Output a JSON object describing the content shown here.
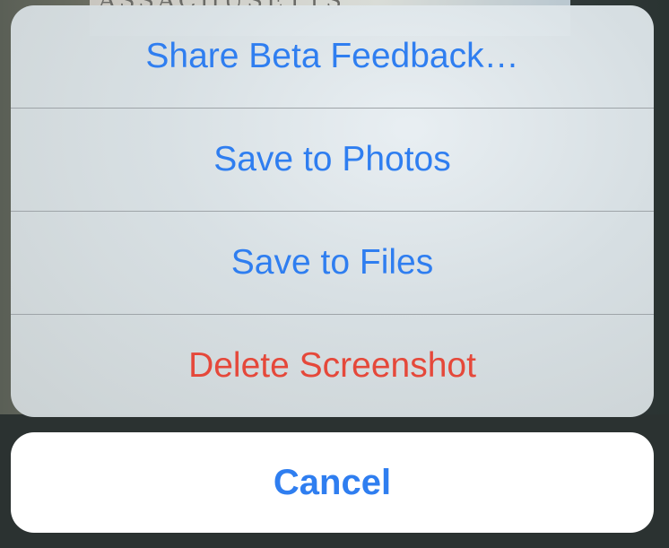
{
  "background": {
    "photo_text": "ASSACHUSETTS"
  },
  "action_sheet": {
    "actions": [
      {
        "label": "Share Beta Feedback…",
        "style": "default",
        "color": "#2f7ef0"
      },
      {
        "label": "Save to Photos",
        "style": "default",
        "color": "#2f7ef0"
      },
      {
        "label": "Save to Files",
        "style": "default",
        "color": "#2f7ef0"
      },
      {
        "label": "Delete Screenshot",
        "style": "destructive",
        "color": "#e5483a"
      }
    ],
    "cancel_label": "Cancel"
  }
}
